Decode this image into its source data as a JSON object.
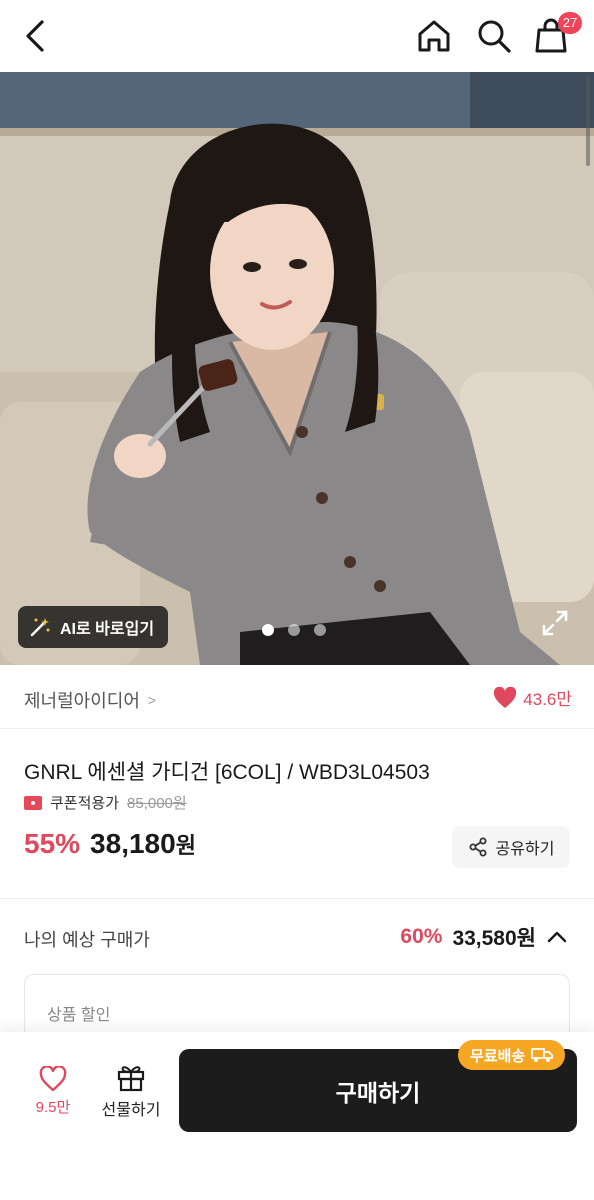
{
  "header": {
    "back_icon": "chevron-left-icon",
    "home_icon": "home-icon",
    "search_icon": "search-icon",
    "cart_icon": "shopping-bag-icon",
    "cart_count": "27"
  },
  "hero": {
    "ai_button_label": "AI로 바로입기",
    "ai_icon": "magic-wand-icon",
    "carousel_total": 3,
    "carousel_active": 1,
    "expand_icon": "expand-icon"
  },
  "brand": {
    "name": "제너럴아이디어",
    "chevron": ">",
    "likes": "43.6만"
  },
  "product": {
    "title": "GNRL 에센셜 가디건 [6COL] / WBD3L04503",
    "coupon_label": "쿠폰적용가",
    "original_price": "85,000원",
    "discount": "55%",
    "price_number": "38,180",
    "price_unit": "원",
    "share_label": "공유하기"
  },
  "expected": {
    "label": "나의 예상 구매가",
    "discount": "60%",
    "price": "33,580원",
    "card_label": "상품 할인"
  },
  "bottom": {
    "wish_count": "9.5만",
    "gift_label": "선물하기",
    "buy_label": "구매하기",
    "free_ship_label": "무료배송"
  },
  "colors": {
    "accent": "#e0485d",
    "buy_button": "#1c1c1c",
    "free_ship": "#f5a623"
  }
}
